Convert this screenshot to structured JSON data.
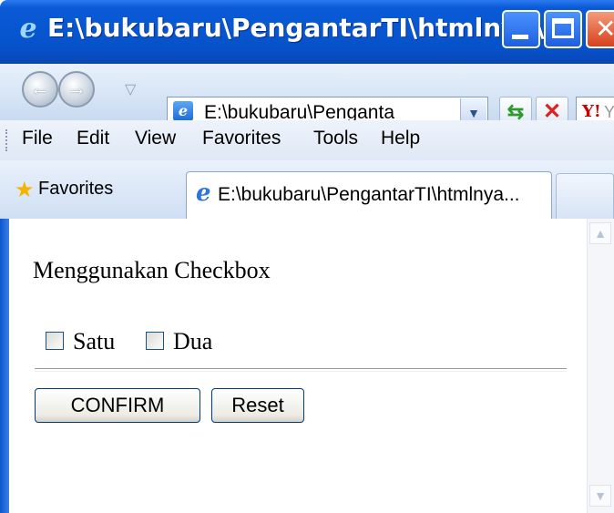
{
  "window": {
    "title": "E:\\bukubaru\\PengantarTI\\htmlnya\\..."
  },
  "navbar": {
    "address": "E:\\bukubaru\\Penganta",
    "search_text": "Ya"
  },
  "menu": {
    "items": [
      "File",
      "Edit",
      "View",
      "Favorites",
      "Tools",
      "Help"
    ]
  },
  "tabs": {
    "favorites_label": "Favorites",
    "active_tab": "E:\\bukubaru\\PengantarTI\\htmlnya..."
  },
  "page": {
    "heading": "Menggunakan Checkbox",
    "checkboxes": [
      {
        "label": "Satu",
        "checked": false
      },
      {
        "label": "Dua",
        "checked": false
      }
    ],
    "confirm_label": "CONFIRM",
    "reset_label": "Reset"
  },
  "icons": {
    "title": "ie-icon",
    "back": "back-arrow-icon",
    "forward": "forward-arrow-icon",
    "refresh": "refresh-icon",
    "stop": "stop-icon",
    "search_provider": "yahoo-icon",
    "favorites": "star-icon"
  }
}
